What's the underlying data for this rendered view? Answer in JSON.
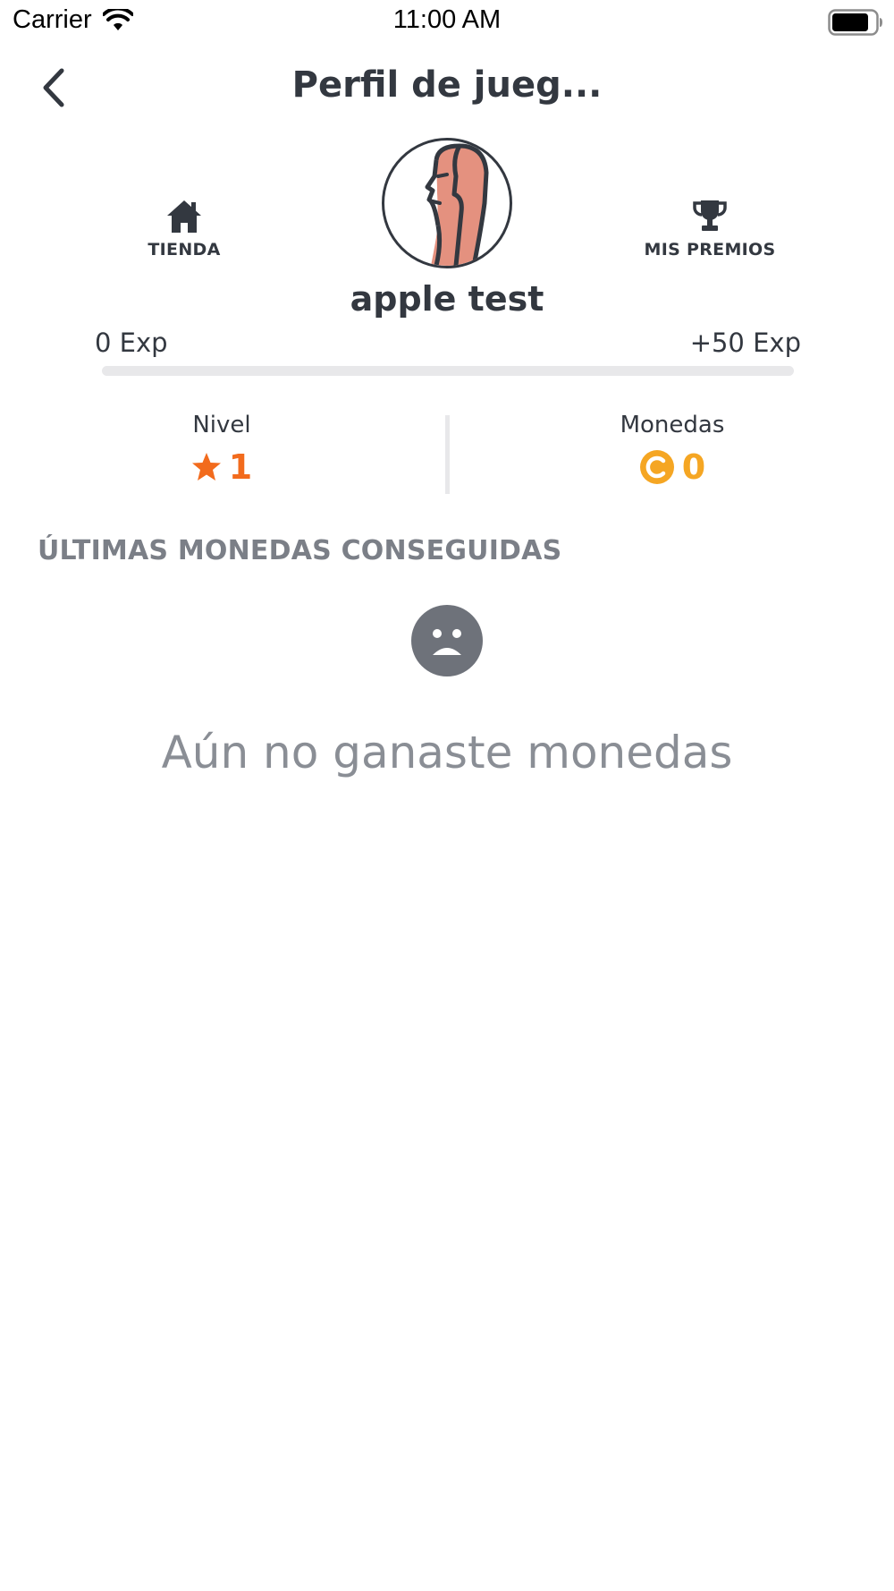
{
  "status_bar": {
    "carrier": "Carrier",
    "time": "11:00 AM"
  },
  "nav": {
    "title": "Perfil de jueg..."
  },
  "shortcuts": {
    "store_label": "TIENDA",
    "store_icon": "house-icon",
    "prizes_label": "MIS PREMIOS",
    "prizes_icon": "trophy-icon"
  },
  "profile": {
    "username": "apple test",
    "avatar_icon": "avatar-face-icon"
  },
  "experience": {
    "current_label": "0 Exp",
    "next_label": "+50 Exp",
    "progress": 0
  },
  "stats": {
    "level_label": "Nivel",
    "level_value": "1",
    "coins_label": "Monedas",
    "coins_value": "0"
  },
  "recent_coins": {
    "title": "ÚLTIMAS MONEDAS CONSEGUIDAS",
    "empty_icon": "sad-face-icon",
    "empty_message": "Aún no ganaste monedas"
  },
  "colors": {
    "primary_text": "#333840",
    "accent_orange": "#f26b1d",
    "coin_yellow": "#f5a623",
    "muted_gray": "#7b7f87",
    "avatar_skin": "#e4917f"
  }
}
